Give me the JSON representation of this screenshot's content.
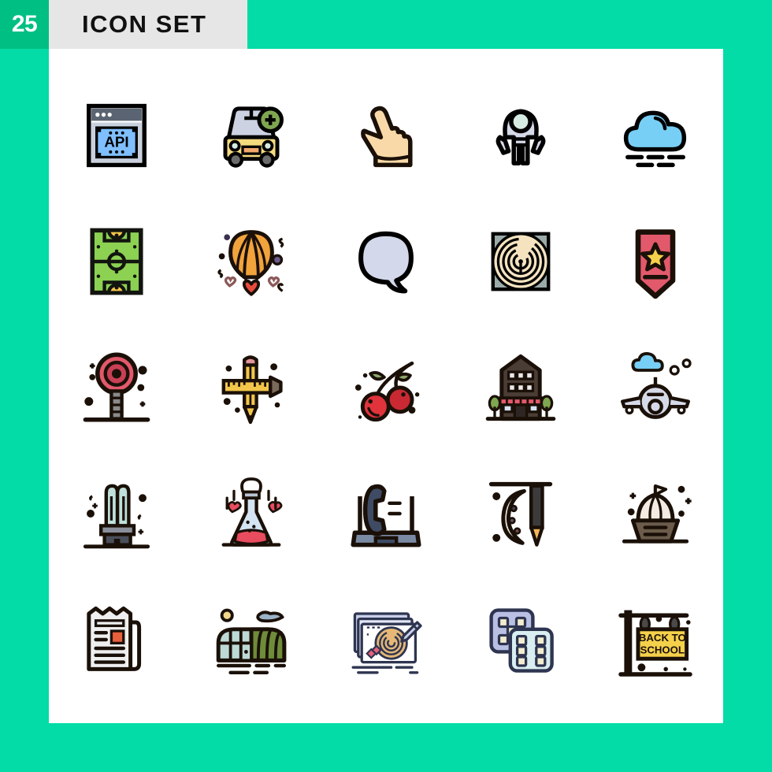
{
  "header": {
    "count": "25",
    "title": "ICON SET",
    "badge_color": "#00BF82",
    "titlebar_color": "#E6E6E6",
    "background_color": "#03DCA7",
    "panel_color": "#FFFFFF"
  },
  "grid": {
    "columns": 5,
    "rows": 5,
    "total": 25
  },
  "icons": [
    {
      "index": 1,
      "name": "api-browser-window-icon",
      "label": "API",
      "row": 1,
      "col": 1,
      "colors": [
        "#000000",
        "#5A6472",
        "#7FBFFF",
        "#C9D0DD"
      ]
    },
    {
      "index": 2,
      "name": "add-car-icon",
      "label": "Add Car",
      "row": 1,
      "col": 2,
      "colors": [
        "#000000",
        "#F5DB7E",
        "#CDD2E3",
        "#7FA650"
      ]
    },
    {
      "index": 3,
      "name": "hand-tap-gesture-icon",
      "label": "Tap",
      "row": 1,
      "col": 3,
      "colors": [
        "#1A1008",
        "#FAD9A8"
      ]
    },
    {
      "index": 4,
      "name": "astronaut-icon",
      "label": "Astronaut",
      "row": 1,
      "col": 4,
      "colors": [
        "#000000",
        "#D5D9E8",
        "#D6EBE2"
      ]
    },
    {
      "index": 5,
      "name": "cloud-fog-icon",
      "label": "Foggy",
      "row": 1,
      "col": 5,
      "colors": [
        "#000000",
        "#77CFF5"
      ]
    },
    {
      "index": 6,
      "name": "soccer-field-icon",
      "label": "Field",
      "row": 2,
      "col": 1,
      "colors": [
        "#12140F",
        "#8CD152",
        "#F2C64A"
      ]
    },
    {
      "index": 7,
      "name": "hot-air-balloon-icon",
      "label": "Balloon",
      "row": 2,
      "col": 2,
      "colors": [
        "#1A1008",
        "#F2A33C",
        "#E84C3D",
        "#6B5B8C"
      ]
    },
    {
      "index": 8,
      "name": "chat-bubble-icon",
      "label": "Chat",
      "row": 2,
      "col": 3,
      "colors": [
        "#000000",
        "#D3D8EA"
      ]
    },
    {
      "index": 9,
      "name": "maze-circular-icon",
      "label": "Maze",
      "row": 2,
      "col": 4,
      "colors": [
        "#000000",
        "#F5E3C0",
        "#9AAAA8"
      ]
    },
    {
      "index": 10,
      "name": "star-badge-icon",
      "label": "Badge",
      "row": 2,
      "col": 5,
      "colors": [
        "#1A1008",
        "#E2596B",
        "#F5D04A"
      ]
    },
    {
      "index": 11,
      "name": "lollipop-target-icon",
      "label": "Lollipop",
      "row": 3,
      "col": 1,
      "colors": [
        "#1A1008",
        "#E2596B",
        "#8A8A8A"
      ]
    },
    {
      "index": 12,
      "name": "pencil-ruler-icon",
      "label": "Design",
      "row": 3,
      "col": 2,
      "colors": [
        "#1A1008",
        "#F2C64A",
        "#E2959B",
        "#7A6A5A"
      ]
    },
    {
      "index": 13,
      "name": "cherry-fruit-icon",
      "label": "Cherry",
      "row": 3,
      "col": 3,
      "colors": [
        "#1A1008",
        "#E0333C",
        "#8FA86B"
      ]
    },
    {
      "index": 14,
      "name": "shop-building-icon",
      "label": "Shop",
      "row": 3,
      "col": 4,
      "colors": [
        "#1A1008",
        "#4A3D36",
        "#E2596B",
        "#7FA650"
      ]
    },
    {
      "index": 15,
      "name": "airplane-front-icon",
      "label": "Airplane",
      "row": 3,
      "col": 5,
      "colors": [
        "#1A1008",
        "#D6DAE8",
        "#77CFF5"
      ]
    },
    {
      "index": 16,
      "name": "energy-bulb-icon",
      "label": "CFL Bulb",
      "row": 4,
      "col": 1,
      "colors": [
        "#1A1008",
        "#BFE0DB",
        "#4A4F5C"
      ]
    },
    {
      "index": 17,
      "name": "love-potion-flask-icon",
      "label": "Potion",
      "row": 4,
      "col": 2,
      "colors": [
        "#1A1008",
        "#D5E4F2",
        "#E84C5E"
      ]
    },
    {
      "index": 18,
      "name": "telephone-support-icon",
      "label": "Telephone",
      "row": 4,
      "col": 3,
      "colors": [
        "#1A1008",
        "#3E4B63",
        "#7B8AA3"
      ]
    },
    {
      "index": 19,
      "name": "moon-pen-icon",
      "label": "Night Pen",
      "row": 4,
      "col": 4,
      "colors": [
        "#1A1008",
        "#F2EDE0",
        "#3B3B3B",
        "#F5B45A"
      ]
    },
    {
      "index": 20,
      "name": "sailboat-icon",
      "label": "Sailboat",
      "row": 4,
      "col": 5,
      "colors": [
        "#1A1008",
        "#F2EDE0",
        "#6B5B4A"
      ]
    },
    {
      "index": 21,
      "name": "newspaper-icon",
      "label": "News",
      "row": 5,
      "col": 1,
      "colors": [
        "#1A1008",
        "#EFEFEF",
        "#E8603C"
      ]
    },
    {
      "index": 22,
      "name": "greenhouse-icon",
      "label": "Greenhouse",
      "row": 5,
      "col": 2,
      "colors": [
        "#1A1008",
        "#BDD9D6",
        "#6E8C3A",
        "#F2D88A"
      ]
    },
    {
      "index": 23,
      "name": "maze-worksheet-icon",
      "label": "Worksheet",
      "row": 5,
      "col": 3,
      "colors": [
        "#2E3550",
        "#E6B877",
        "#C9CFE8",
        "#E8607C"
      ]
    },
    {
      "index": 24,
      "name": "dice-pair-icon",
      "label": "Dice",
      "row": 5,
      "col": 4,
      "colors": [
        "#2E3550",
        "#B9C0E4",
        "#D9EEF0",
        "#F2EDCE"
      ]
    },
    {
      "index": 25,
      "name": "back-to-school-sign-icon",
      "label": "BACK TO SCHOOL",
      "row": 5,
      "col": 5,
      "text_line1": "BACK TO",
      "text_line2": "SCHOOL",
      "colors": [
        "#1A1008",
        "#F5D04A"
      ]
    }
  ]
}
